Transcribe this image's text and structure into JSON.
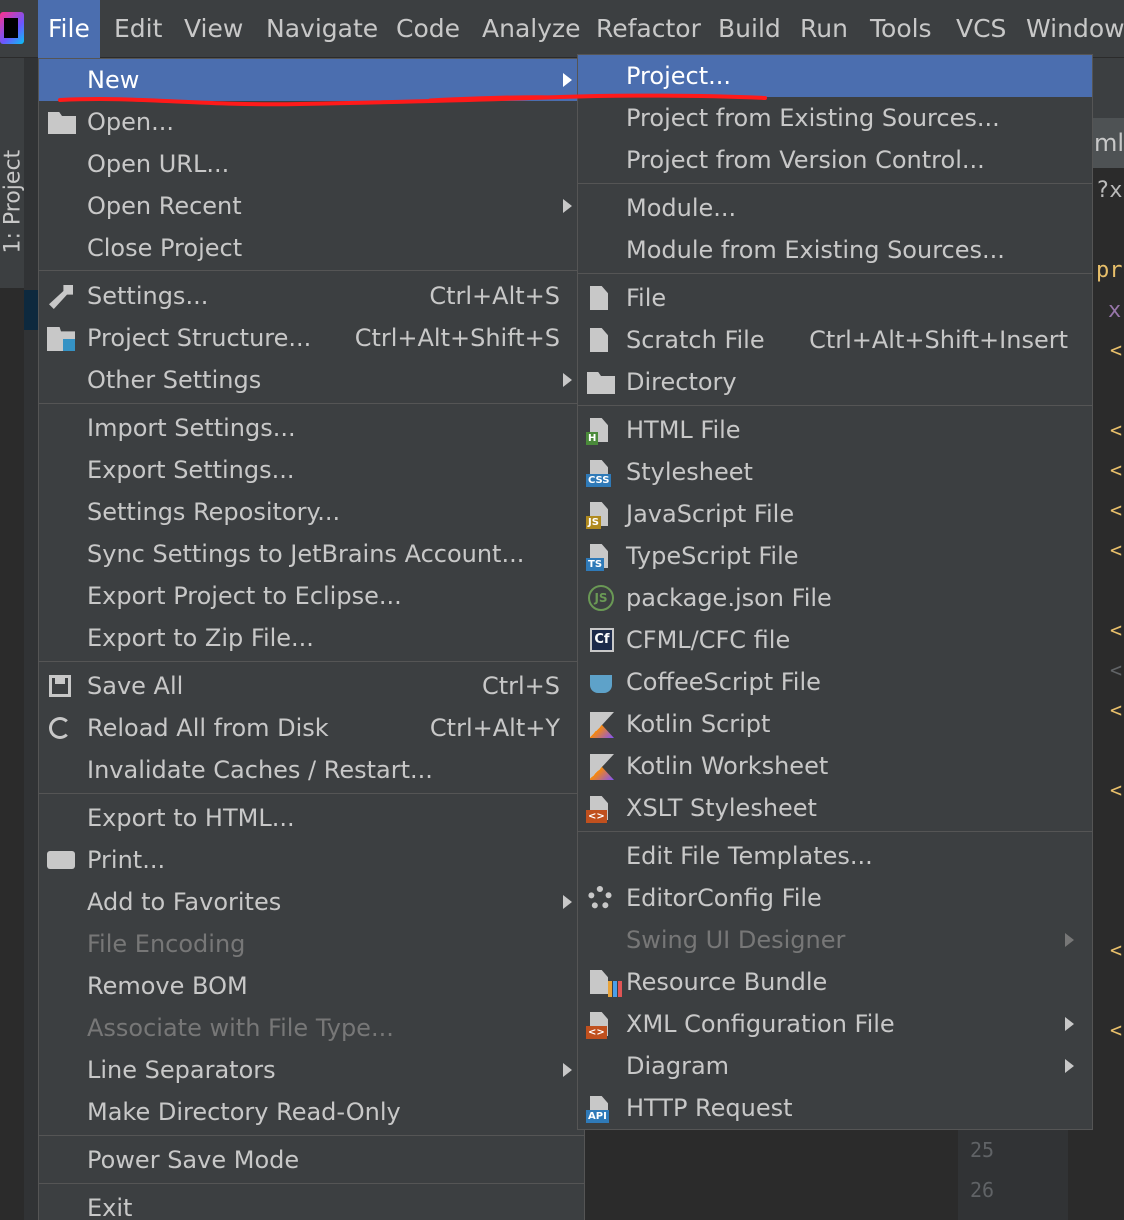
{
  "menubar": {
    "items": [
      "File",
      "Edit",
      "View",
      "Navigate",
      "Code",
      "Analyze",
      "Refactor",
      "Build",
      "Run",
      "Tools",
      "VCS",
      "Window"
    ]
  },
  "background": {
    "tool_window_label": "1: Project",
    "editor_tab": "ml",
    "code_line_1": "?xı",
    "code_line_2": "pro",
    "code_line_3": "x",
    "brackets": [
      "<",
      "<",
      "<",
      "<",
      "<",
      "<",
      "<",
      "<",
      "<",
      "<",
      "<",
      "<"
    ],
    "line_numbers": [
      "25",
      "26"
    ]
  },
  "file_menu": {
    "items": [
      {
        "label": "New",
        "submenu": true
      },
      {
        "label": "Open..."
      },
      {
        "label": "Open URL..."
      },
      {
        "label": "Open Recent",
        "submenu": true
      },
      {
        "label": "Close Project"
      },
      {
        "label": "Settings...",
        "shortcut": "Ctrl+Alt+S",
        "icon": "wrench-icon"
      },
      {
        "label": "Project Structure...",
        "shortcut": "Ctrl+Alt+Shift+S",
        "icon": "project-structure-icon"
      },
      {
        "label": "Other Settings",
        "submenu": true
      },
      {
        "label": "Import Settings..."
      },
      {
        "label": "Export Settings..."
      },
      {
        "label": "Settings Repository..."
      },
      {
        "label": "Sync Settings to JetBrains Account..."
      },
      {
        "label": "Export Project to Eclipse..."
      },
      {
        "label": "Export to Zip File..."
      },
      {
        "label": "Save All",
        "shortcut": "Ctrl+S",
        "icon": "save-icon"
      },
      {
        "label": "Reload All from Disk",
        "shortcut": "Ctrl+Alt+Y",
        "icon": "reload-icon"
      },
      {
        "label": "Invalidate Caches / Restart..."
      },
      {
        "label": "Export to HTML..."
      },
      {
        "label": "Print...",
        "icon": "printer-icon"
      },
      {
        "label": "Add to Favorites",
        "submenu": true
      },
      {
        "label": "File Encoding",
        "disabled": true
      },
      {
        "label": "Remove BOM"
      },
      {
        "label": "Associate with File Type...",
        "disabled": true
      },
      {
        "label": "Line Separators",
        "submenu": true
      },
      {
        "label": "Make Directory Read-Only"
      },
      {
        "label": "Power Save Mode"
      },
      {
        "label": "Exit"
      }
    ]
  },
  "new_submenu": {
    "items": [
      {
        "label": "Project..."
      },
      {
        "label": "Project from Existing Sources..."
      },
      {
        "label": "Project from Version Control..."
      },
      {
        "label": "Module..."
      },
      {
        "label": "Module from Existing Sources..."
      },
      {
        "label": "File"
      },
      {
        "label": "Scratch File",
        "shortcut": "Ctrl+Alt+Shift+Insert"
      },
      {
        "label": "Directory"
      },
      {
        "label": "HTML File",
        "badge": "H"
      },
      {
        "label": "Stylesheet",
        "badge": "CSS"
      },
      {
        "label": "JavaScript File",
        "badge": "JS"
      },
      {
        "label": "TypeScript File",
        "badge": "TS"
      },
      {
        "label": "package.json File",
        "badge": "JS"
      },
      {
        "label": "CFML/CFC file",
        "badge": "Cf"
      },
      {
        "label": "CoffeeScript File"
      },
      {
        "label": "Kotlin Script"
      },
      {
        "label": "Kotlin Worksheet"
      },
      {
        "label": "XSLT Stylesheet",
        "badge": "<>"
      },
      {
        "label": "Edit File Templates..."
      },
      {
        "label": "EditorConfig File"
      },
      {
        "label": "Swing UI Designer",
        "disabled": true,
        "submenu": true
      },
      {
        "label": "Resource Bundle"
      },
      {
        "label": "XML Configuration File",
        "submenu": true,
        "badge": "<>"
      },
      {
        "label": "Diagram",
        "submenu": true
      },
      {
        "label": "HTTP Request",
        "badge": "API"
      }
    ]
  },
  "colors": {
    "selection": "#4b6eaf",
    "menu_bg": "#3c3f41",
    "annotation": "#ff1a1a"
  }
}
